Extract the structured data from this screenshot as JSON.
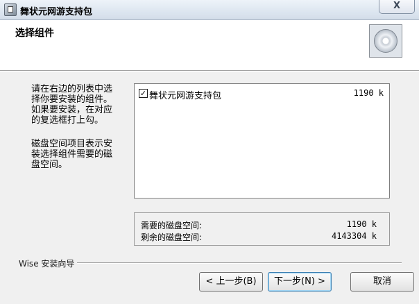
{
  "window": {
    "title": "舞状元网游支持包",
    "close_label": "X"
  },
  "header": {
    "title": "选择组件"
  },
  "description": {
    "paragraph1": "请在右边的列表中选择你要安装的组件。如果要安装，在对应的复选框打上勾。",
    "paragraph2": "磁盘空间项目表示安装选择组件需要的磁盘空间。"
  },
  "components": [
    {
      "name": "舞状元网游支持包",
      "size": "1190 k",
      "checked": true
    }
  ],
  "disk": {
    "required_label": "需要的磁盘空间:",
    "required_value": "1190 k",
    "remaining_label": "剩余的磁盘空间:",
    "remaining_value": "4143304 k"
  },
  "footer": {
    "wizard_label": "Wise 安装向导",
    "back_button": "< 上一步(B)",
    "next_button": "下一步(N) >",
    "cancel_button": "取消"
  }
}
